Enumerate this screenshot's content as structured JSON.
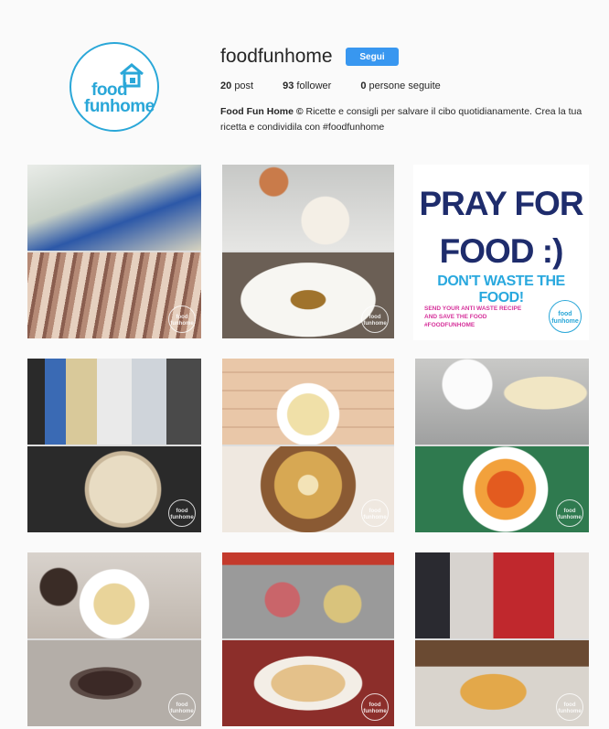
{
  "profile": {
    "username": "foodfunhome",
    "follow_label": "Segui",
    "posts_count": "20",
    "posts_label": "post",
    "followers_count": "93",
    "followers_label": "follower",
    "following_count": "0",
    "following_label": "persone seguite",
    "bio_name": "Food Fun Home ©",
    "bio_text": " Ricette e consigli per salvare il cibo quotidianamente. Crea la tua ricetta e condividila con #foodfunhome",
    "logo_line1": "food",
    "logo_line2": "funhome"
  },
  "pray_post": {
    "line1": "PRAY FOR",
    "line2": "FOOD :)",
    "line3": "DON'T WASTE THE FOOD!",
    "line4": "SEND YOUR ANTI WASTE RECIPE AND SAVE THE FOOD #FOODFUNHOME",
    "badge": "food funhome"
  },
  "watermark": "food funhome",
  "colors": {
    "accent": "#3897f0",
    "brand": "#2aa7d8",
    "navy": "#1e2c6c",
    "pink": "#d6329b"
  }
}
